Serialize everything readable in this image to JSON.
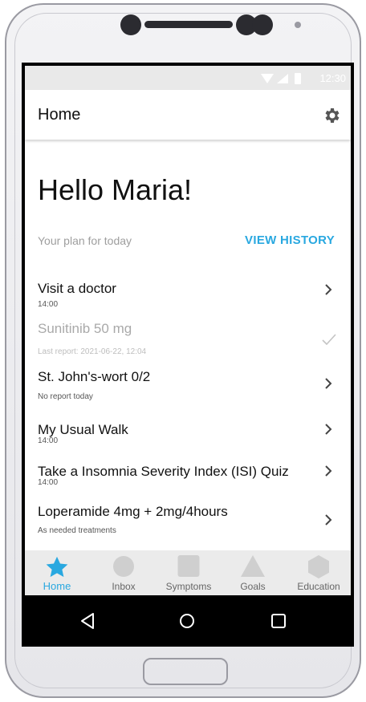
{
  "status_bar": {
    "time": "12:30"
  },
  "app_bar": {
    "title": "Home",
    "settings_icon": "gear-icon"
  },
  "greeting": "Hello Maria!",
  "plan": {
    "label": "Your plan for today",
    "view_history": "VIEW HISTORY"
  },
  "items": [
    {
      "title": "Visit a doctor",
      "subtitle": "14:00",
      "state": "pending",
      "trailing": "chevron-right-icon"
    },
    {
      "title": "Sunitinib 50 mg",
      "subtitle": "Last report: 2021-06-22, 12:04",
      "state": "done",
      "trailing": "checkmark-icon"
    },
    {
      "title": "St. John's-wort 0/2",
      "subtitle": "No report today",
      "state": "pending",
      "trailing": "chevron-right-icon"
    },
    {
      "title": "My Usual Walk",
      "subtitle": "14:00",
      "state": "pending",
      "trailing": "chevron-right-icon"
    },
    {
      "title": "Take a Insomnia Severity Index (ISI) Quiz",
      "subtitle": "14:00",
      "state": "pending",
      "trailing": "chevron-right-icon"
    },
    {
      "title": "Loperamide 4mg + 2mg/4hours",
      "subtitle": "As needed treatments",
      "state": "pending",
      "trailing": "chevron-right-icon"
    }
  ],
  "bottom_nav": [
    {
      "label": "Home",
      "icon": "star-icon",
      "active": true
    },
    {
      "label": "Inbox",
      "icon": "circle-icon",
      "active": false
    },
    {
      "label": "Symptoms",
      "icon": "square-icon",
      "active": false
    },
    {
      "label": "Goals",
      "icon": "triangle-icon",
      "active": false
    },
    {
      "label": "Education",
      "icon": "hexagon-icon",
      "active": false
    }
  ],
  "system_nav": [
    "back-icon",
    "home-icon",
    "recents-icon"
  ],
  "colors": {
    "accent": "#29a8e0",
    "annotation_arrow": "#e8311f",
    "nav_background": "#ebebeb"
  }
}
